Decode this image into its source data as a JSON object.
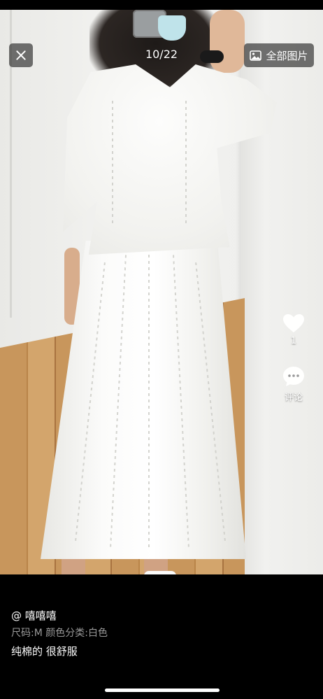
{
  "viewer": {
    "counter": "10/22",
    "all_photos_label": "全部图片",
    "close_icon": "close-icon",
    "all_photos_icon": "image-icon"
  },
  "actions": {
    "like_icon": "heart-icon",
    "like_count": "1",
    "comment_icon": "comment-bubble-icon",
    "comment_label": "评论"
  },
  "post": {
    "username": "@ 嘻嘻嘻",
    "meta": "尺码:M 颜色分类:白色",
    "description": "纯棉的 很舒服"
  },
  "colors": {
    "background": "#000000",
    "overlay_button": "rgba(40,40,40,0.65)",
    "meta_text": "#9a9a9a",
    "text": "#ffffff"
  }
}
